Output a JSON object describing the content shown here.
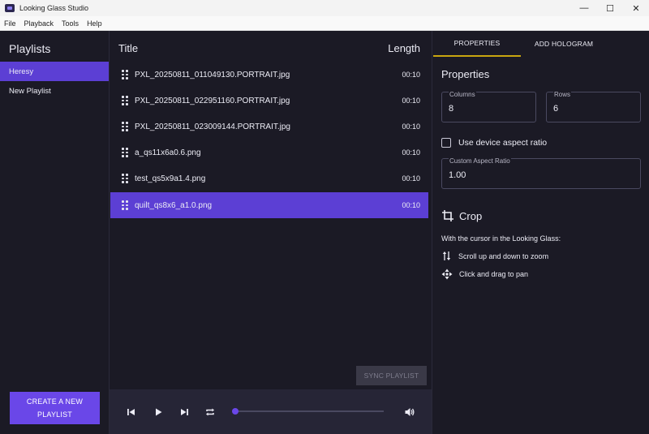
{
  "window": {
    "title": "Looking Glass Studio",
    "controls": [
      "—",
      "☐",
      "✕"
    ]
  },
  "menu": [
    "File",
    "Playback",
    "Tools",
    "Help"
  ],
  "sidebar": {
    "title": "Playlists",
    "items": [
      {
        "label": "Heresy",
        "active": true
      },
      {
        "label": "New Playlist",
        "active": false
      }
    ],
    "create_label": "CREATE A NEW PLAYLIST"
  },
  "playlist": {
    "title_header": "Title",
    "length_header": "Length",
    "rows": [
      {
        "name": "PXL_20250811_011049130.PORTRAIT.jpg",
        "length": "00:10"
      },
      {
        "name": "PXL_20250811_022951160.PORTRAIT.jpg",
        "length": "00:10"
      },
      {
        "name": "PXL_20250811_023009144.PORTRAIT.jpg",
        "length": "00:10"
      },
      {
        "name": "a_qs11x6a0.6.png",
        "length": "00:10"
      },
      {
        "name": "test_qs5x9a1.4.png",
        "length": "00:10"
      },
      {
        "name": "quilt_qs8x6_a1.0.png",
        "length": "00:10",
        "selected": true
      }
    ],
    "sync_label": "SYNC PLAYLIST",
    "progress": 0.0
  },
  "right": {
    "tabs": [
      {
        "label": "PROPERTIES",
        "active": true
      },
      {
        "label": "ADD HOLOGRAM",
        "active": false
      }
    ],
    "properties_heading": "Properties",
    "columns": {
      "label": "Columns",
      "value": "8"
    },
    "rows": {
      "label": "Rows",
      "value": "6"
    },
    "aspect_checkbox": {
      "label": "Use device aspect ratio",
      "checked": false
    },
    "custom_aspect": {
      "label": "Custom Aspect Ratio",
      "value": "1.00"
    },
    "crop_heading": "Crop",
    "crop_instruction": "With the cursor in the Looking Glass:",
    "hints": [
      {
        "icon": "scroll-arrows-icon",
        "text": "Scroll up and down to zoom"
      },
      {
        "icon": "move-arrows-icon",
        "text": "Click and drag to pan"
      }
    ]
  },
  "colors": {
    "accent": "#6a47e8",
    "selected": "#5c3fd4",
    "tab_underline": "#c9a60f",
    "background": "#1b1a25",
    "player_bar": "#262536"
  }
}
